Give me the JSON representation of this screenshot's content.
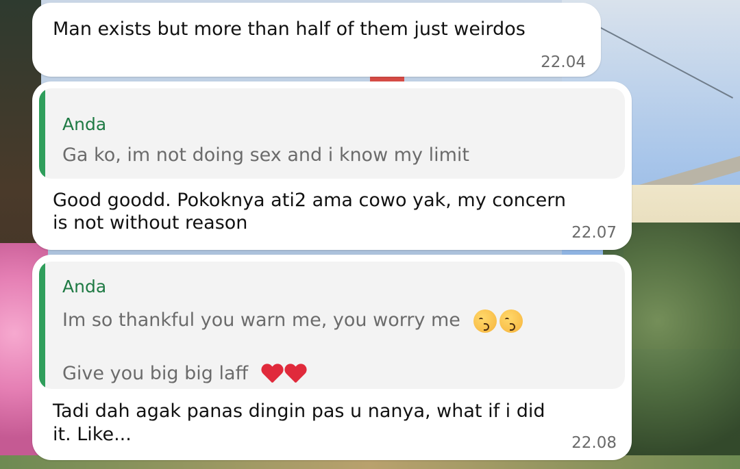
{
  "chat": {
    "messages": [
      {
        "text": "Man exists but more than half of them just weirdos",
        "time": "22.04"
      },
      {
        "reply": {
          "author": "Anda",
          "text": "Ga ko, im not doing sex and i know my limit"
        },
        "text_line1": "Good goodd. Pokoknya ati2 ama cowo yak, my concern",
        "text_line2": "is not without reason",
        "time": "22.07"
      },
      {
        "reply": {
          "author": "Anda",
          "line1": "Im so thankful you warn me, you worry me",
          "line1_emojis": [
            "kissing-face-emoji",
            "kissing-face-emoji"
          ],
          "line2": "Give you big big laff",
          "line2_emojis": [
            "red-heart-emoji",
            "red-heart-emoji"
          ]
        },
        "text_line1": "Tadi dah agak panas dingin pas u nanya, what if i did",
        "text_line2": "it. Like...",
        "time": "22.08"
      }
    ]
  },
  "colors": {
    "quote_bar": "#2f9e5b",
    "quote_author": "#1f7a44",
    "bubble": "#ffffff"
  }
}
